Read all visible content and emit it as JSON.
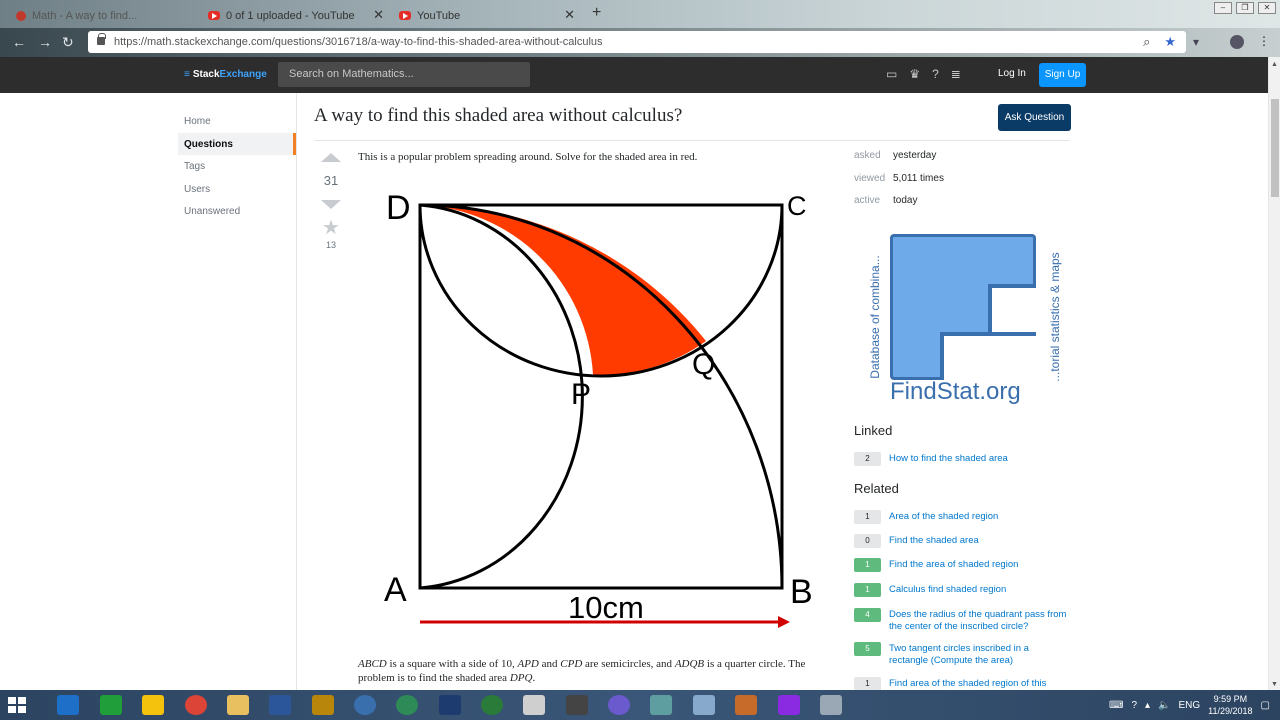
{
  "browser": {
    "tabs": [
      {
        "title": "Math - A way to find...",
        "active": false
      },
      {
        "title": "0 of 1 uploaded - YouTube",
        "active": false
      },
      {
        "title": "YouTube",
        "active": true
      }
    ],
    "url": "https://math.stackexchange.com/questions/3016718/a-way-to-find-this-shaded-area-without-calculus"
  },
  "topbar": {
    "logo_prefix": "Stack",
    "logo_suffix": "Exchange",
    "search_placeholder": "Search on Mathematics...",
    "login": "Log In",
    "signup": "Sign Up"
  },
  "nav": {
    "items": [
      "Home",
      "Questions",
      "Tags",
      "Users",
      "Unanswered"
    ],
    "active": "Questions"
  },
  "question": {
    "title": "A way to find this shaded area without calculus?",
    "ask_button": "Ask Question",
    "votes": "31",
    "favorites": "13",
    "intro": "This is a popular problem spreading around. Solve for the shaded area in red.",
    "body_parts": [
      "ABCD",
      " is a square with a side of ",
      "10",
      ", ",
      "APD",
      " and ",
      "CPD",
      " are semicircles, and ",
      "ADQB",
      " is a quarter circle. The problem is to find the shaded area ",
      "DPQ",
      "."
    ],
    "figure": {
      "labels": {
        "D": "D",
        "C": "C",
        "A": "A",
        "B": "B",
        "P": "P",
        "Q": "Q"
      },
      "measure": "10cm",
      "fill_color": "#ff3b00",
      "arrow_color": "#d00000"
    }
  },
  "stats": [
    {
      "key": "asked",
      "value": "yesterday"
    },
    {
      "key": "viewed",
      "value": "5,011 times"
    },
    {
      "key": "active",
      "value": "today"
    }
  ],
  "ad": {
    "name": "FindStat.org",
    "left_text": "Database of combina...",
    "right_text": "...torial statistics & maps"
  },
  "linked": {
    "heading": "Linked",
    "items": [
      {
        "count": "2",
        "title": "How to find the shaded area",
        "answered": false
      }
    ]
  },
  "related": {
    "heading": "Related",
    "items": [
      {
        "count": "1",
        "title": "Area of the shaded region",
        "answered": false
      },
      {
        "count": "0",
        "title": "Find the shaded area",
        "answered": false
      },
      {
        "count": "1",
        "title": "Find the area of shaded region",
        "answered": true
      },
      {
        "count": "1",
        "title": "Calculus find shaded region",
        "answered": true
      },
      {
        "count": "4",
        "title": "Does the radius of the quadrant pass from the center of the inscribed circle?",
        "answered": true
      },
      {
        "count": "5",
        "title": "Two tangent circles inscribed in a rectangle (Compute the area)",
        "answered": true
      },
      {
        "count": "1",
        "title": "Find area of the shaded region of this",
        "answered": false
      }
    ]
  },
  "taskbar": {
    "lang": "ENG",
    "time": "9:59 PM",
    "date": "11/29/2018"
  }
}
